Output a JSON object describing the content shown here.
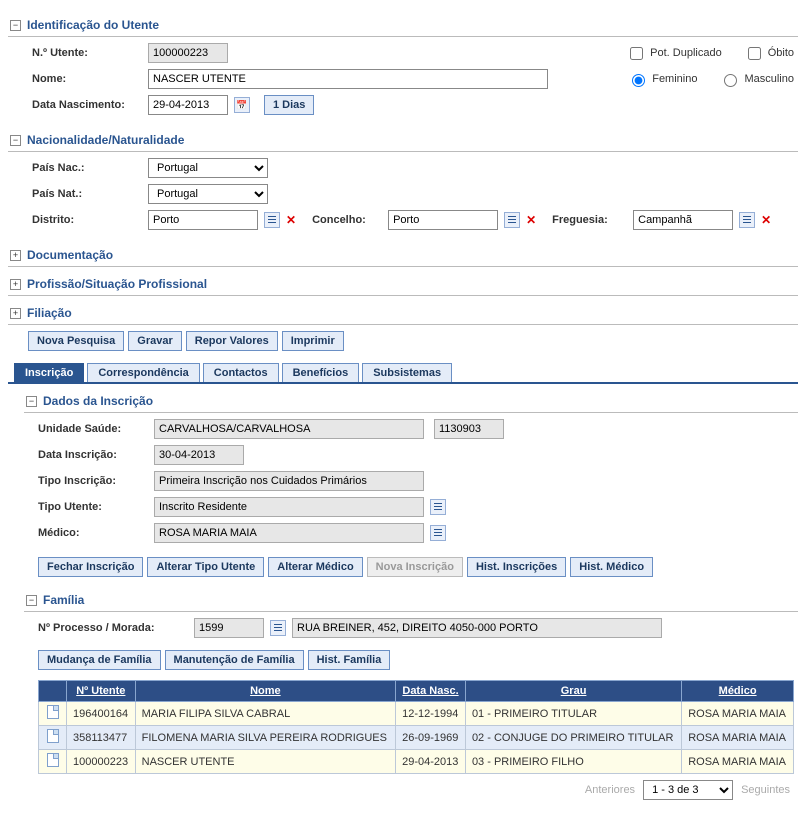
{
  "ident": {
    "title": "Identificação do Utente",
    "numLabel": "N.º Utente:",
    "num": "100000223",
    "nomeLabel": "Nome:",
    "nome": "NASCER UTENTE",
    "dataNascLabel": "Data Nascimento:",
    "dataNasc": "29-04-2013",
    "diasBtn": "1 Dias",
    "potDup": "Pot. Duplicado",
    "obito": "Óbito",
    "fem": "Feminino",
    "masc": "Masculino"
  },
  "nac": {
    "title": "Nacionalidade/Naturalidade",
    "paisNacLabel": "País Nac.:",
    "paisNac": "Portugal",
    "paisNatLabel": "País Nat.:",
    "paisNat": "Portugal",
    "distritoLabel": "Distrito:",
    "distrito": "Porto",
    "concelhoLabel": "Concelho:",
    "concelho": "Porto",
    "freguesiaLabel": "Freguesia:",
    "freguesia": "Campanhã"
  },
  "collapsed": {
    "doc": "Documentação",
    "prof": "Profissão/Situação Profissional",
    "fil": "Filiação"
  },
  "topButtons": {
    "nova": "Nova Pesquisa",
    "gravar": "Gravar",
    "repor": "Repor Valores",
    "imprimir": "Imprimir"
  },
  "tabs": {
    "inscricao": "Inscrição",
    "corresp": "Correspondência",
    "contactos": "Contactos",
    "beneficios": "Benefícios",
    "subsist": "Subsistemas"
  },
  "dados": {
    "title": "Dados da Inscrição",
    "unidadeLabel": "Unidade Saúde:",
    "unidadeNome": "CARVALHOSA/CARVALHOSA",
    "unidadeCod": "1130903",
    "dataInscLabel": "Data Inscrição:",
    "dataInsc": "30-04-2013",
    "tipoInscLabel": "Tipo Inscrição:",
    "tipoInsc": "Primeira Inscrição nos Cuidados Primários",
    "tipoUtenteLabel": "Tipo Utente:",
    "tipoUtente": "Inscrito Residente",
    "medicoLabel": "Médico:",
    "medico": "ROSA MARIA MAIA"
  },
  "inscButtons": {
    "fechar": "Fechar Inscrição",
    "altTipo": "Alterar Tipo Utente",
    "altMed": "Alterar Médico",
    "novaInsc": "Nova Inscrição",
    "histInsc": "Hist. Inscrições",
    "histMed": "Hist. Médico"
  },
  "familia": {
    "title": "Família",
    "procLabel": "Nº Processo / Morada:",
    "proc": "1599",
    "morada": "RUA BREINER, 452, DIREITO 4050-000 PORTO",
    "btnMud": "Mudança de Família",
    "btnMan": "Manutenção de Família",
    "btnHist": "Hist. Família",
    "headers": {
      "num": "Nº Utente",
      "nome": "Nome",
      "data": "Data Nasc.",
      "grau": "Grau",
      "medico": "Médico"
    },
    "rows": [
      {
        "num": "196400164",
        "nome": "MARIA FILIPA SILVA CABRAL",
        "data": "12-12-1994",
        "grau": "01 - PRIMEIRO TITULAR",
        "medico": "ROSA MARIA MAIA"
      },
      {
        "num": "358113477",
        "nome": "FILOMENA MARIA SILVA PEREIRA RODRIGUES",
        "data": "26-09-1969",
        "grau": "02 - CONJUGE DO PRIMEIRO TITULAR",
        "medico": "ROSA MARIA MAIA"
      },
      {
        "num": "100000223",
        "nome": "NASCER UTENTE",
        "data": "29-04-2013",
        "grau": "03 - PRIMEIRO FILHO",
        "medico": "ROSA MARIA MAIA"
      }
    ]
  },
  "pager": {
    "ant": "Anteriores",
    "range": "1 - 3 de 3",
    "seg": "Seguintes"
  }
}
